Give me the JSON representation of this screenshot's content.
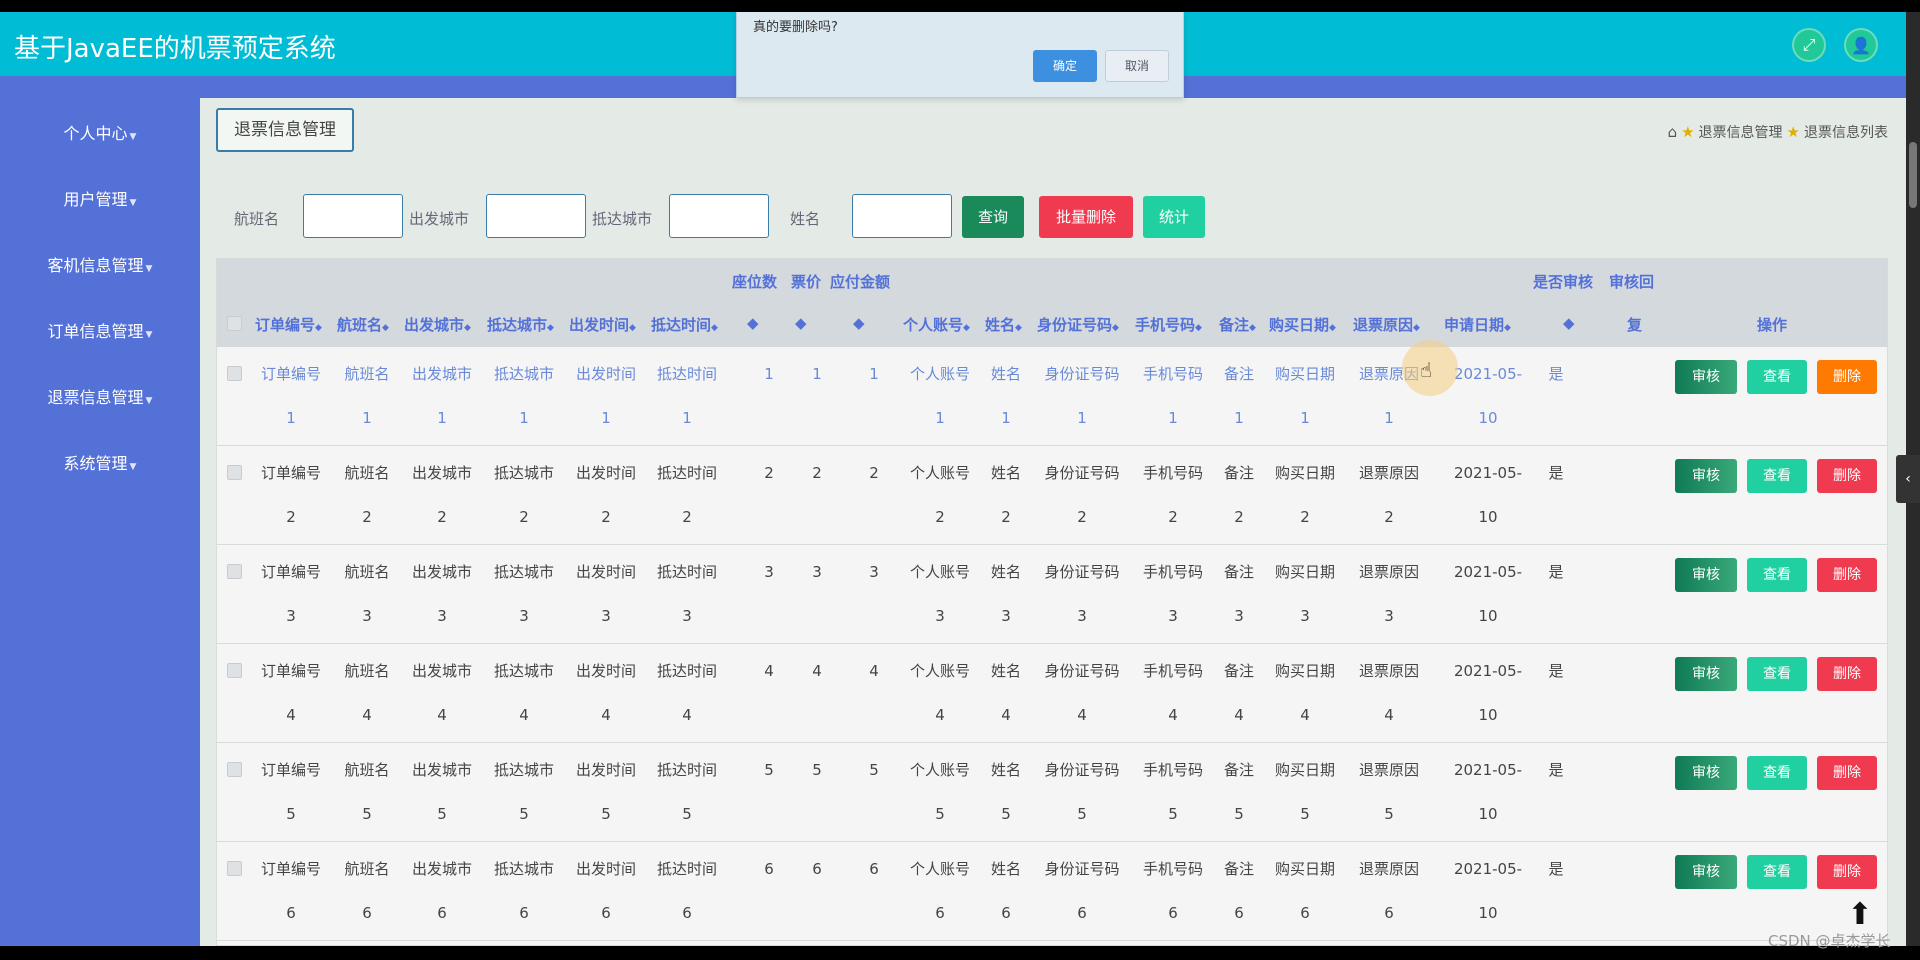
{
  "app_title": "基于JavaEE的机票预定系统",
  "sidebar": {
    "items": [
      {
        "label": "个人中心"
      },
      {
        "label": "用户管理"
      },
      {
        "label": "客机信息管理"
      },
      {
        "label": "订单信息管理"
      },
      {
        "label": "退票信息管理"
      },
      {
        "label": "系统管理"
      }
    ]
  },
  "header": {
    "section_label": "退票信息管理",
    "breadcrumb": [
      "退票信息管理",
      "退票信息列表"
    ]
  },
  "filters": {
    "labels": [
      "航班名",
      "出发城市",
      "抵达城市",
      "姓名"
    ],
    "values": [
      "",
      "",
      "",
      ""
    ],
    "buttons": {
      "query": "查询",
      "batch_delete": "批量删除",
      "stats": "统计"
    }
  },
  "table": {
    "headers": {
      "order_no": "订单编号",
      "flight": "航班名",
      "from": "出发城市",
      "to": "抵达城市",
      "dep": "出发时间",
      "arr": "抵达时间",
      "seats": "座位数",
      "price": "票价",
      "payable": "应付金额",
      "account": "个人账号",
      "name": "姓名",
      "id_no": "身份证号码",
      "phone": "手机号码",
      "remark": "备注",
      "buy_date": "购买日期",
      "reason": "退票原因",
      "apply_date": "申请日期",
      "audited": "是否审核",
      "reply_a": "审核回",
      "reply_b": "复",
      "ops": "操作"
    },
    "sort_icon": "◆",
    "rows": [
      {
        "order_no": "订单编号",
        "flight": "航班名",
        "from": "出发城市",
        "to": "抵达城市",
        "dep": "出发时间",
        "arr": "抵达时间",
        "account": "个人账号",
        "name": "姓名",
        "id_no": "身份证号码",
        "phone": "手机号码",
        "remark": "备注",
        "buy_date": "购买日期",
        "reason": "退票原因",
        "date_a": "2021-05-",
        "date_b": "10",
        "audited": "是",
        "n": "1"
      },
      {
        "order_no": "订单编号",
        "flight": "航班名",
        "from": "出发城市",
        "to": "抵达城市",
        "dep": "出发时间",
        "arr": "抵达时间",
        "account": "个人账号",
        "name": "姓名",
        "id_no": "身份证号码",
        "phone": "手机号码",
        "remark": "备注",
        "buy_date": "购买日期",
        "reason": "退票原因",
        "date_a": "2021-05-",
        "date_b": "10",
        "audited": "是",
        "n": "2"
      },
      {
        "order_no": "订单编号",
        "flight": "航班名",
        "from": "出发城市",
        "to": "抵达城市",
        "dep": "出发时间",
        "arr": "抵达时间",
        "account": "个人账号",
        "name": "姓名",
        "id_no": "身份证号码",
        "phone": "手机号码",
        "remark": "备注",
        "buy_date": "购买日期",
        "reason": "退票原因",
        "date_a": "2021-05-",
        "date_b": "10",
        "audited": "是",
        "n": "3"
      },
      {
        "order_no": "订单编号",
        "flight": "航班名",
        "from": "出发城市",
        "to": "抵达城市",
        "dep": "出发时间",
        "arr": "抵达时间",
        "account": "个人账号",
        "name": "姓名",
        "id_no": "身份证号码",
        "phone": "手机号码",
        "remark": "备注",
        "buy_date": "购买日期",
        "reason": "退票原因",
        "date_a": "2021-05-",
        "date_b": "10",
        "audited": "是",
        "n": "4"
      },
      {
        "order_no": "订单编号",
        "flight": "航班名",
        "from": "出发城市",
        "to": "抵达城市",
        "dep": "出发时间",
        "arr": "抵达时间",
        "account": "个人账号",
        "name": "姓名",
        "id_no": "身份证号码",
        "phone": "手机号码",
        "remark": "备注",
        "buy_date": "购买日期",
        "reason": "退票原因",
        "date_a": "2021-05-",
        "date_b": "10",
        "audited": "是",
        "n": "5"
      },
      {
        "order_no": "订单编号",
        "flight": "航班名",
        "from": "出发城市",
        "to": "抵达城市",
        "dep": "出发时间",
        "arr": "抵达时间",
        "account": "个人账号",
        "name": "姓名",
        "id_no": "身份证号码",
        "phone": "手机号码",
        "remark": "备注",
        "buy_date": "购买日期",
        "reason": "退票原因",
        "date_a": "2021-05-",
        "date_b": "10",
        "audited": "是",
        "n": "6"
      }
    ],
    "row_buttons": {
      "audit": "审核",
      "view": "查看",
      "delete": "删除"
    }
  },
  "dialog": {
    "message": "真的要删除吗?",
    "ok": "确定",
    "cancel": "取消"
  },
  "watermark": "CSDN @卓杰学长",
  "colors": {
    "topbar": "#00bcd4",
    "sidebar": "#5471d8",
    "delete": "#f03a4f",
    "delete_hover": "#ff7a00",
    "view": "#20d0a0",
    "audit": "#0f7a55"
  }
}
